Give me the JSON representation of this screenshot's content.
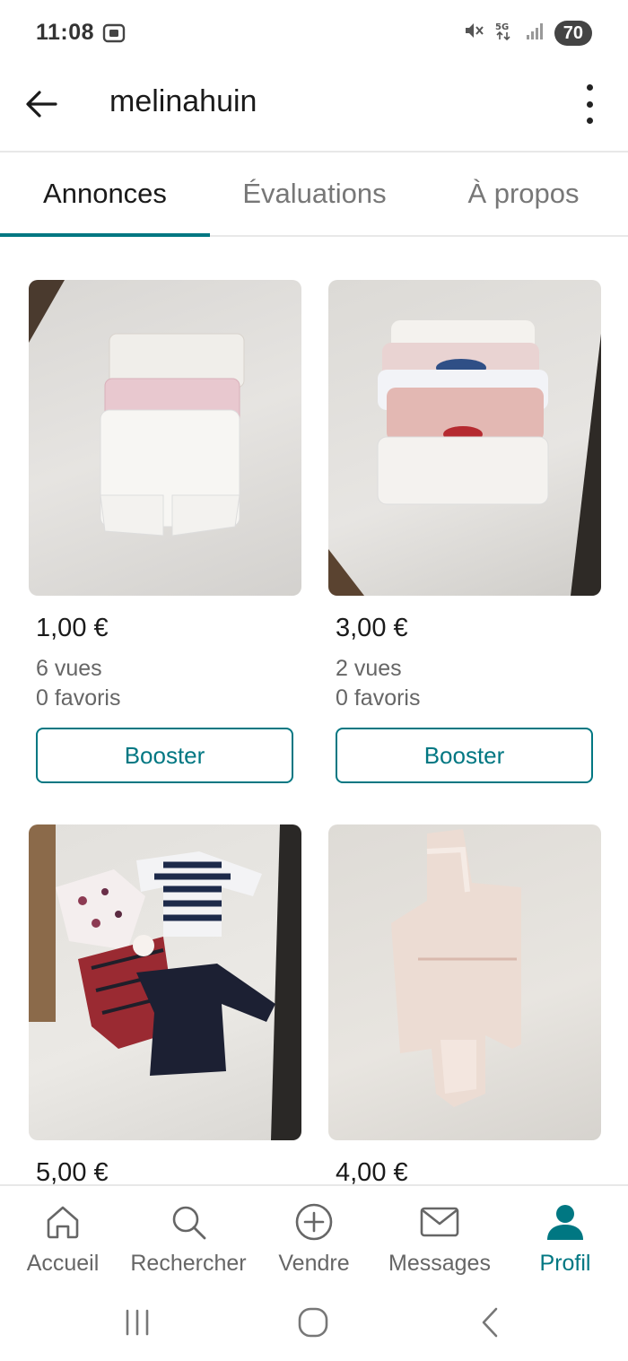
{
  "status_bar": {
    "time": "11:08",
    "battery": "70"
  },
  "header": {
    "username": "melinahuin"
  },
  "tabs": [
    {
      "label": "Annonces",
      "active": true
    },
    {
      "label": "Évaluations",
      "active": false
    },
    {
      "label": "À propos",
      "active": false
    }
  ],
  "listings": [
    {
      "price": "1,00 €",
      "views": "6 vues",
      "favorites": "0 favoris",
      "button": "Booster",
      "photo": "white-and-pink-baby-shorts"
    },
    {
      "price": "3,00 €",
      "views": "2 vues",
      "favorites": "0 favoris",
      "button": "Booster",
      "photo": "stack-of-baby-long-sleeve-tops"
    },
    {
      "price": "5,00 €",
      "photo": "baby-dresses-and-tops"
    },
    {
      "price": "4,00 €",
      "photo": "fluffy-baby-cardigan"
    }
  ],
  "bottom_nav": [
    {
      "label": "Accueil",
      "icon": "home-icon",
      "active": false
    },
    {
      "label": "Rechercher",
      "icon": "search-icon",
      "active": false
    },
    {
      "label": "Vendre",
      "icon": "plus-circle-icon",
      "active": false
    },
    {
      "label": "Messages",
      "icon": "envelope-icon",
      "active": false
    },
    {
      "label": "Profil",
      "icon": "profile-icon",
      "active": true
    }
  ],
  "colors": {
    "accent": "#007782",
    "text": "#1a1a1a",
    "muted": "#666666"
  }
}
